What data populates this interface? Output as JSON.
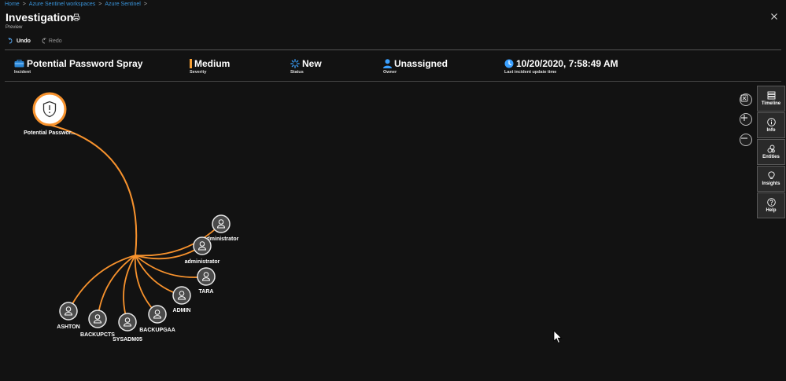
{
  "breadcrumb": {
    "items": [
      "Home",
      "Azure Sentinel workspaces",
      "Azure Sentinel"
    ]
  },
  "header": {
    "title": "Investigation",
    "subtitle": "Preview"
  },
  "toolbar": {
    "undo": "Undo",
    "redo": "Redo"
  },
  "summary": {
    "incident": {
      "value": "Potential Password Spray",
      "label": "Incident"
    },
    "severity": {
      "value": "Medium",
      "label": "Severity",
      "color": "#f7a035"
    },
    "status": {
      "value": "New",
      "label": "Status"
    },
    "owner": {
      "value": "Unassigned",
      "label": "Owner"
    },
    "updated": {
      "value": "10/20/2020, 7:58:49 AM",
      "label": "Last incident update time"
    }
  },
  "graph": {
    "edge_color": "#f7922d",
    "incident_node": {
      "label": "Potential Passwor...",
      "icon": "shield-alert-icon"
    },
    "entities": [
      {
        "label": "administrator",
        "icon": "user-icon"
      },
      {
        "label": "administrator",
        "icon": "user-icon"
      },
      {
        "label": "TARA",
        "icon": "user-icon"
      },
      {
        "label": "ADMIN",
        "icon": "user-icon"
      },
      {
        "label": "BACKUPGAA",
        "icon": "user-icon"
      },
      {
        "label": "SYSADM05",
        "icon": "user-icon"
      },
      {
        "label": "BACKUPCTS",
        "icon": "user-icon"
      },
      {
        "label": "ASHTON",
        "icon": "user-icon"
      }
    ]
  },
  "sidepanel": [
    {
      "label": "Timeline",
      "icon": "timeline-icon"
    },
    {
      "label": "Info",
      "icon": "info-icon"
    },
    {
      "label": "Entities",
      "icon": "entities-icon"
    },
    {
      "label": "Insights",
      "icon": "lightbulb-icon"
    },
    {
      "label": "Help",
      "icon": "help-icon"
    }
  ]
}
